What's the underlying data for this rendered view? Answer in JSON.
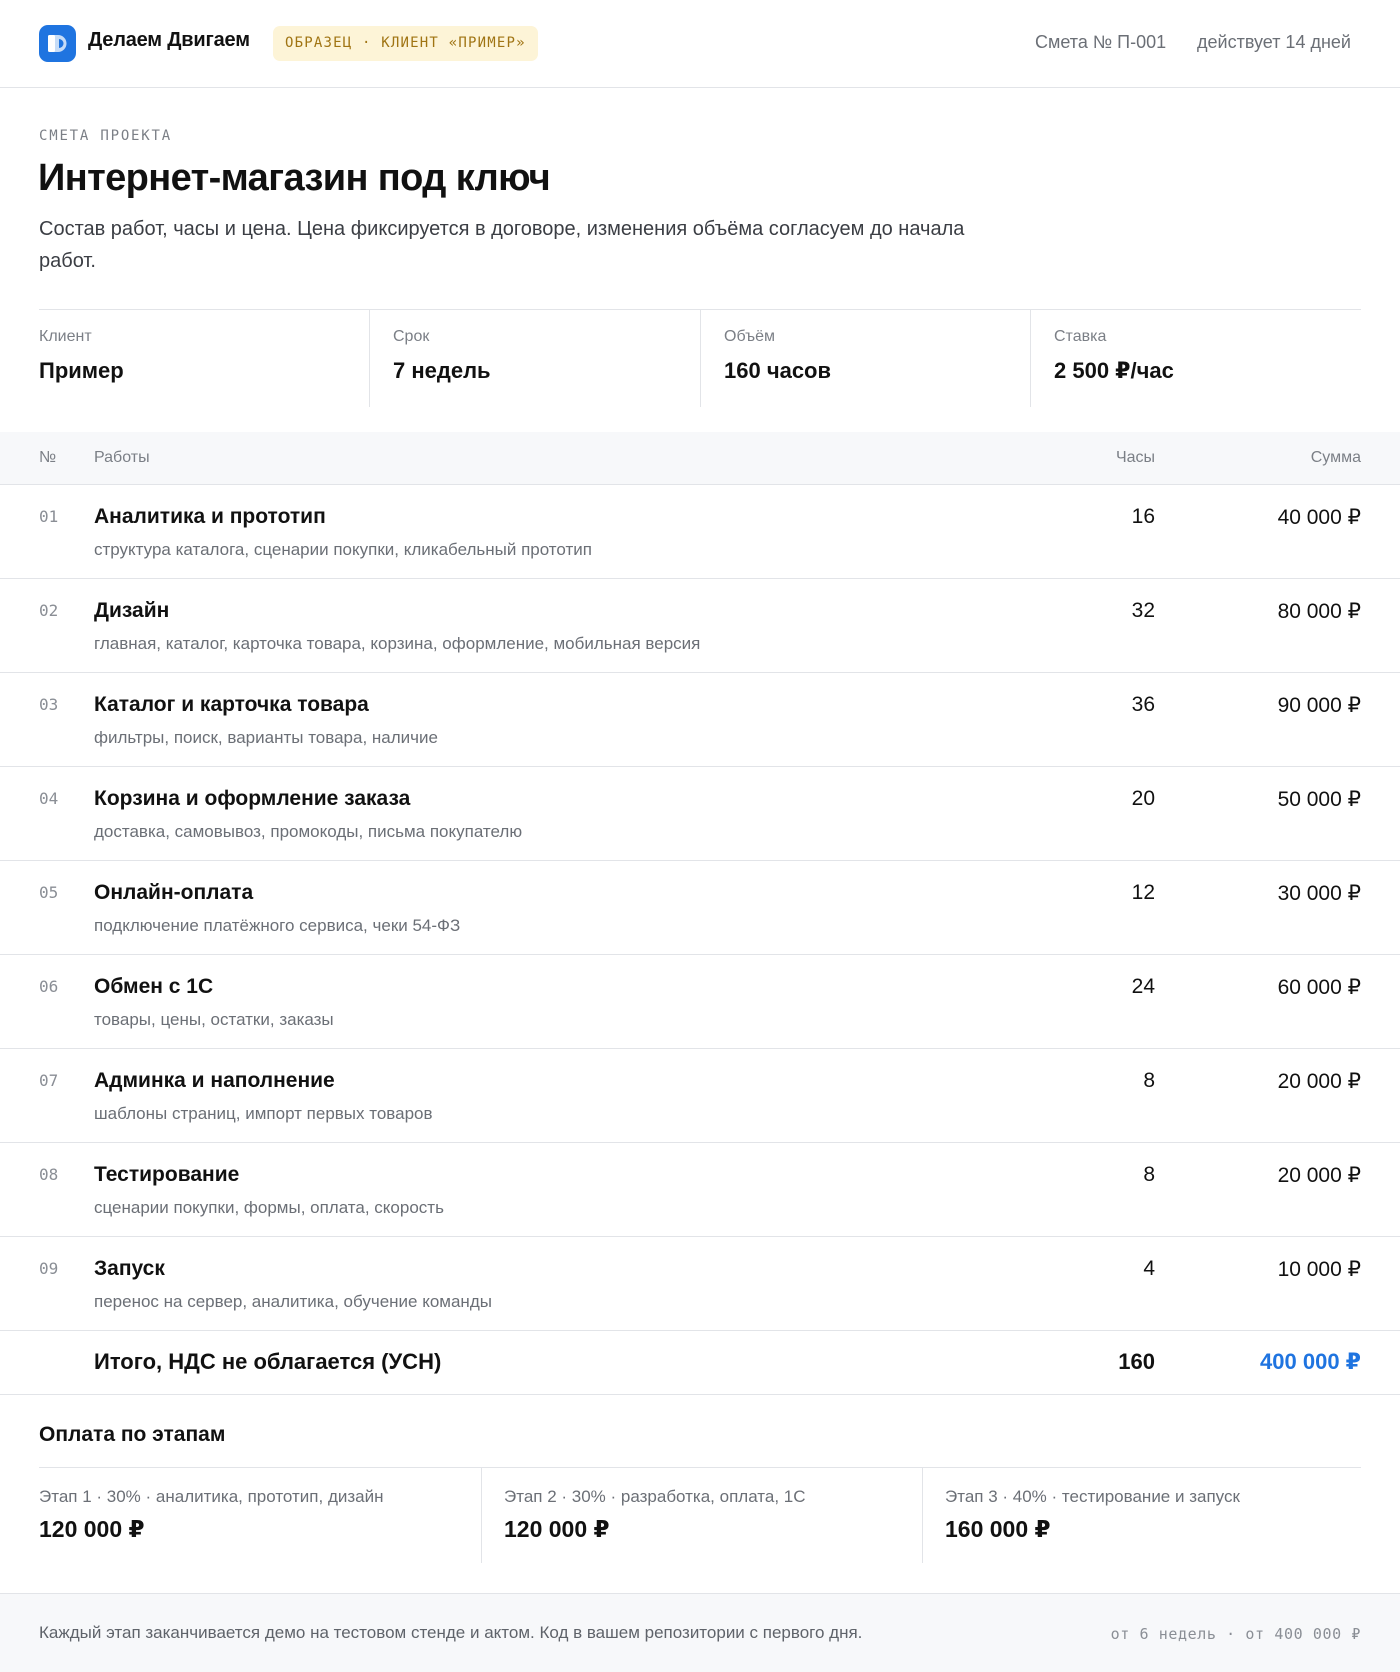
{
  "header": {
    "brand": "Делаем Двигаем",
    "badge": "ОБРАЗЕЦ · КЛИЕНТ «ПРИМЕР»",
    "estimate_number": "Смета № П-001",
    "validity": "действует 14 дней",
    "accent_color": "#1f74e0"
  },
  "intro": {
    "eyebrow": "СМЕТА ПРОЕКТА",
    "title": "Интернет-магазин под ключ",
    "subtitle": "Состав работ, часы и цена. Цена фиксируется в договоре, изменения объёма согласуем до начала работ."
  },
  "summary": [
    {
      "label": "Клиент",
      "value": "Пример"
    },
    {
      "label": "Срок",
      "value": "7 недель"
    },
    {
      "label": "Объём",
      "value": "160 часов"
    },
    {
      "label": "Ставка",
      "value": "2 500 ₽/час"
    }
  ],
  "table": {
    "headers": {
      "num": "№",
      "work": "Работы",
      "hours": "Часы",
      "sum": "Сумма"
    },
    "rows": [
      {
        "num": "01",
        "title": "Аналитика и прототип",
        "desc": "структура каталога, сценарии покупки, кликабельный прототип",
        "hours": "16",
        "amount": "40 000 ₽"
      },
      {
        "num": "02",
        "title": "Дизайн",
        "desc": "главная, каталог, карточка товара, корзина, оформление, мобильная версия",
        "hours": "32",
        "amount": "80 000 ₽"
      },
      {
        "num": "03",
        "title": "Каталог и карточка товара",
        "desc": "фильтры, поиск, варианты товара, наличие",
        "hours": "36",
        "amount": "90 000 ₽"
      },
      {
        "num": "04",
        "title": "Корзина и оформление заказа",
        "desc": "доставка, самовывоз, промокоды, письма покупателю",
        "hours": "20",
        "amount": "50 000 ₽"
      },
      {
        "num": "05",
        "title": "Онлайн-оплата",
        "desc": "подключение платёжного сервиса, чеки 54-ФЗ",
        "hours": "12",
        "amount": "30 000 ₽"
      },
      {
        "num": "06",
        "title": "Обмен с 1С",
        "desc": "товары, цены, остатки, заказы",
        "hours": "24",
        "amount": "60 000 ₽"
      },
      {
        "num": "07",
        "title": "Админка и наполнение",
        "desc": "шаблоны страниц, импорт первых товаров",
        "hours": "8",
        "amount": "20 000 ₽"
      },
      {
        "num": "08",
        "title": "Тестирование",
        "desc": "сценарии покупки, формы, оплата, скорость",
        "hours": "8",
        "amount": "20 000 ₽"
      },
      {
        "num": "09",
        "title": "Запуск",
        "desc": "перенос на сервер, аналитика, обучение команды",
        "hours": "4",
        "amount": "10 000 ₽"
      }
    ],
    "total": {
      "label": "Итого, НДС не облагается (УСН)",
      "hours": "160",
      "amount": "400 000 ₽"
    }
  },
  "payment": {
    "title": "Оплата по этапам",
    "stages": [
      {
        "label": "Этап 1 · 30% · аналитика, прототип, дизайн",
        "amount": "120 000 ₽"
      },
      {
        "label": "Этап 2 · 30% · разработка, оплата, 1С",
        "amount": "120 000 ₽"
      },
      {
        "label": "Этап 3 · 40% · тестирование и запуск",
        "amount": "160 000 ₽"
      }
    ]
  },
  "footer": {
    "note": "Каждый этап заканчивается демо на тестовом стенде и актом. Код в вашем репозитории с первого дня.",
    "meta": "от 6 недель · от 400 000 ₽"
  }
}
